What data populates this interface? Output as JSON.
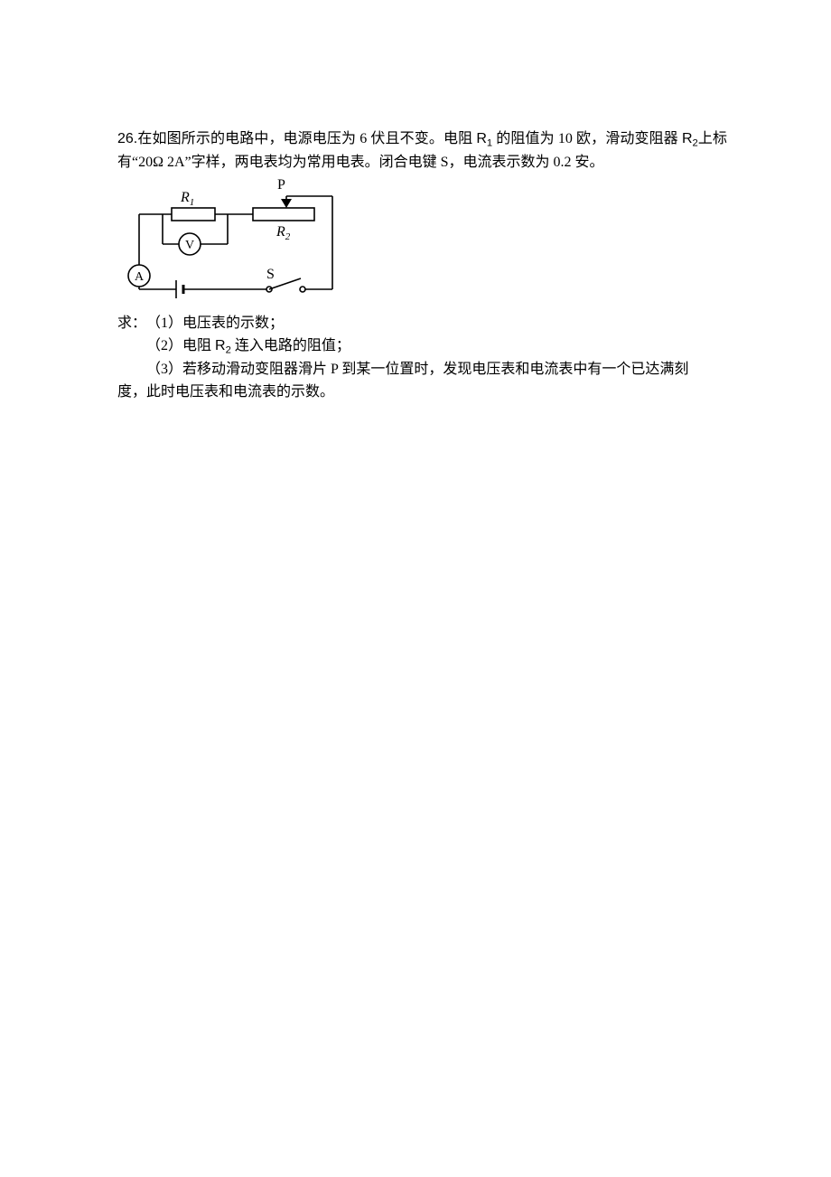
{
  "problem": {
    "number": "26.",
    "intro_before_R1": "在如图所示的电路中，电源电压为 6 伏且不变。电阻 ",
    "R1_html": "R<sub>1</sub>",
    "intro_mid": " 的阻值为 10 欧，滑动变阻器 ",
    "R2_html": "R<sub>2</sub>",
    "intro_after_R2": "上标有“20Ω 2A”字样，两电表均为常用电表。闭合电键 S，电流表示数为 0.2 安。",
    "prompt": "求：",
    "q1": "（1）电压表的示数；",
    "q2_before": "（2）电阻 ",
    "q2_after": " 连入电路的阻值；",
    "q3": "（3）若移动滑动变阻器滑片 P 到某一位置时，发现电压表和电流表中有一个已达满刻",
    "q3_tail": "度，此时电压表和电流表的示数。"
  },
  "diagram": {
    "R1": "R",
    "R1_sub": "1",
    "R2": "R",
    "R2_sub": "2",
    "P": "P",
    "S": "S",
    "V": "V",
    "A": "A"
  }
}
